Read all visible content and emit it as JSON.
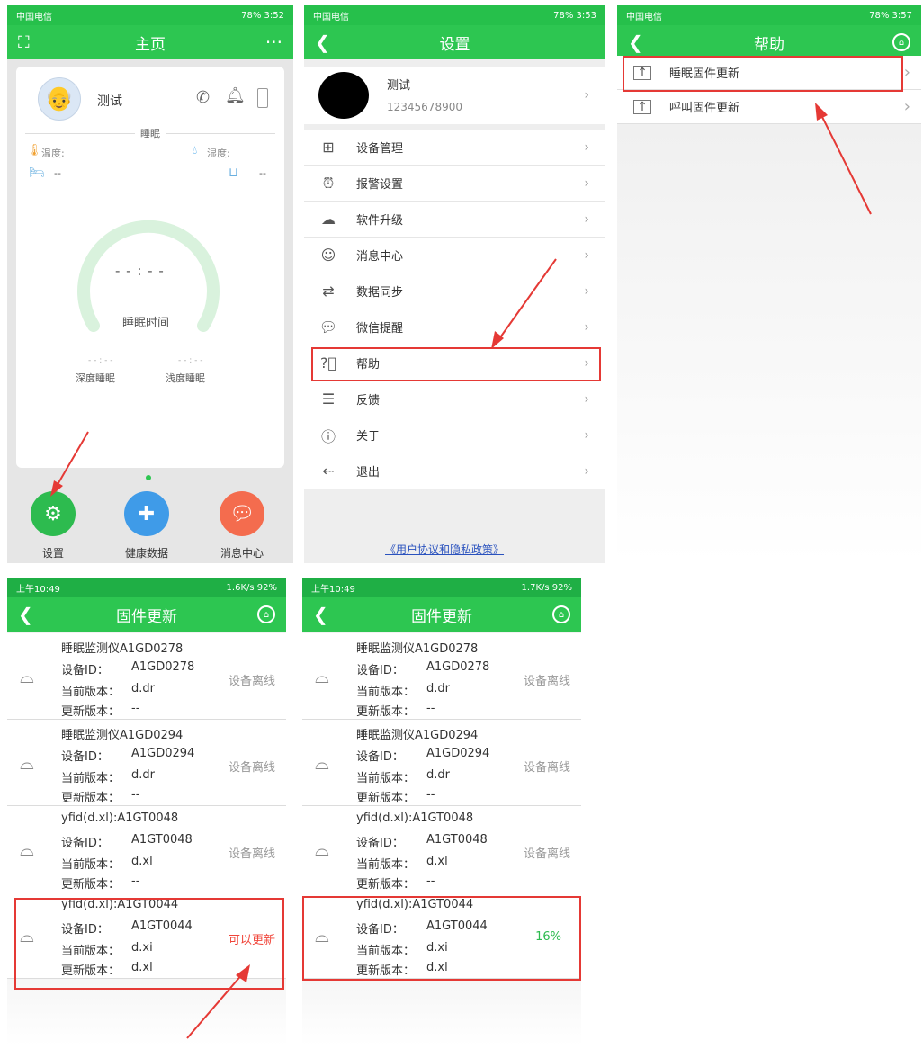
{
  "panel1": {
    "status": {
      "carrier": "中国电信",
      "right": "78%  3:52"
    },
    "nav": {
      "title": "主页",
      "more": "···"
    },
    "user_name": "测试",
    "section": "睡眠",
    "temp_label": "温度:",
    "humidity_label": "湿度:",
    "bed_left": "--",
    "bed_right": "--",
    "gauge_time": "- - : - -",
    "gauge_label": "睡眠时间",
    "deep_value": "- - : - -",
    "deep_label": "深度睡眠",
    "light_value": "- - : - -",
    "light_label": "浅度睡眠",
    "dock": [
      {
        "label": "设置",
        "color": "#2dbb4f"
      },
      {
        "label": "健康数据",
        "color": "#3f9be8"
      },
      {
        "label": "消息中心",
        "color": "#f46c4e"
      }
    ]
  },
  "panel2": {
    "status": {
      "carrier": "中国电信",
      "right": "78%  3:53"
    },
    "nav": {
      "title": "设置"
    },
    "profile": {
      "name": "测试",
      "phone": "12345678900"
    },
    "items": [
      {
        "label": "设备管理",
        "icon": "grid-icon"
      },
      {
        "label": "报警设置",
        "icon": "alarm-icon"
      },
      {
        "label": "软件升级",
        "icon": "cloud-upload-icon"
      },
      {
        "label": "消息中心",
        "icon": "message-icon"
      },
      {
        "label": "数据同步",
        "icon": "sync-icon"
      },
      {
        "label": "微信提醒",
        "icon": "wechat-icon"
      },
      {
        "label": "帮助",
        "icon": "help-icon"
      },
      {
        "label": "反馈",
        "icon": "feedback-icon"
      },
      {
        "label": "关于",
        "icon": "info-icon"
      },
      {
        "label": "退出",
        "icon": "logout-icon"
      }
    ],
    "footer_link": "《用户协议和隐私政策》"
  },
  "panel3": {
    "status": {
      "carrier": "中国电信",
      "right": "78%  3:57"
    },
    "nav": {
      "title": "帮助"
    },
    "items": [
      {
        "label": "睡眠固件更新"
      },
      {
        "label": "呼叫固件更新"
      }
    ]
  },
  "firmware": {
    "title": "固件更新",
    "labels": {
      "device_id": "设备ID：",
      "current": "当前版本：",
      "update": "更新版本："
    },
    "left": {
      "status": {
        "time": "上午10:49",
        "right": "1.6K/s  92%"
      },
      "devices": [
        {
          "name": "睡眠监测仪A1GD0278",
          "id": "A1GD0278",
          "current": "d.dr",
          "update": "--",
          "state": "设备离线"
        },
        {
          "name": "睡眠监测仪A1GD0294",
          "id": "A1GD0294",
          "current": "d.dr",
          "update": "--",
          "state": "设备离线"
        },
        {
          "name": "yfid(d.xl):A1GT0048",
          "id": "A1GT0048",
          "current": "d.xl",
          "update": "--",
          "state": "设备离线"
        },
        {
          "name": "yfid(d.xl):A1GT0044",
          "id": "A1GT0044",
          "current": "d.xi",
          "update": "d.xl",
          "state": "可以更新"
        }
      ]
    },
    "right": {
      "status": {
        "time": "上午10:49",
        "right": "1.7K/s  92%"
      },
      "devices": [
        {
          "name": "睡眠监测仪A1GD0278",
          "id": "A1GD0278",
          "current": "d.dr",
          "update": "--",
          "state": "设备离线"
        },
        {
          "name": "睡眠监测仪A1GD0294",
          "id": "A1GD0294",
          "current": "d.dr",
          "update": "--",
          "state": "设备离线"
        },
        {
          "name": "yfid(d.xl):A1GT0048",
          "id": "A1GT0048",
          "current": "d.xl",
          "update": "--",
          "state": "设备离线"
        },
        {
          "name": "yfid(d.xl):A1GT0044",
          "id": "A1GT0044",
          "current": "d.xi",
          "update": "d.xl",
          "state": "16%"
        }
      ]
    }
  },
  "colors": {
    "green": "#2dc651",
    "highlight": "#e53935",
    "progress": "#2dbb4f",
    "update_text": "#f0453a"
  }
}
